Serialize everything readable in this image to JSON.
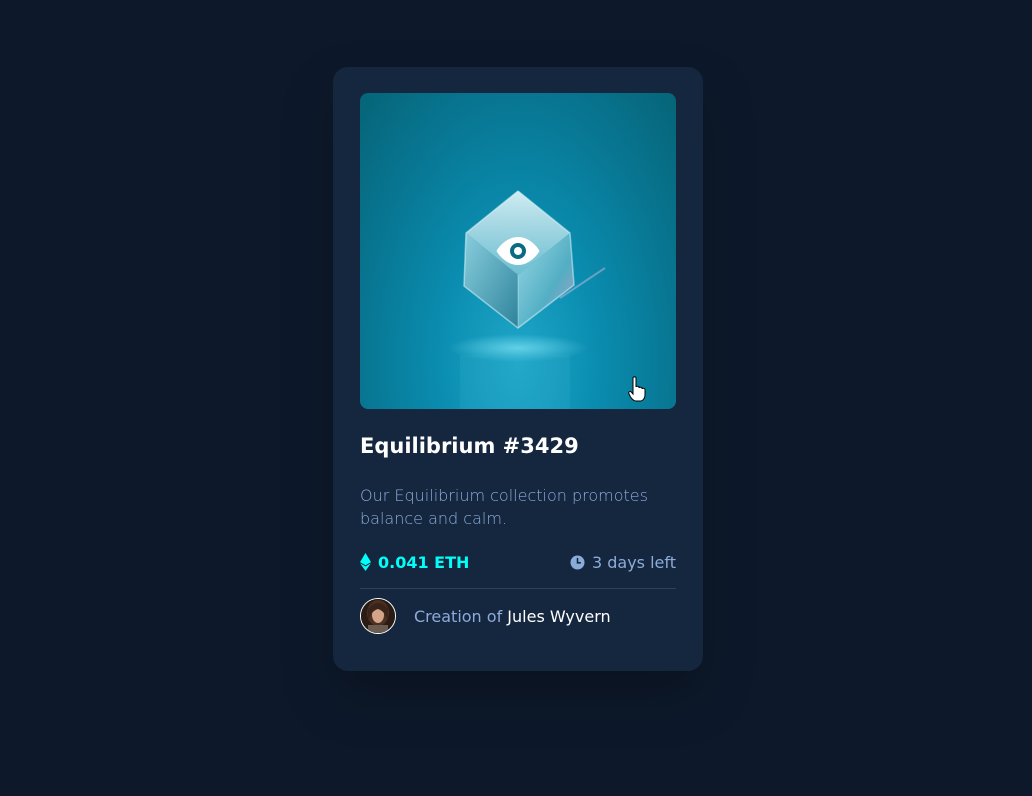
{
  "card": {
    "title": "Equilibrium #3429",
    "description": "Our Equilibrium collection promotes balance and calm.",
    "price": "0.041 ETH",
    "time_left": "3 days left",
    "creator_prefix": "Creation of",
    "creator_name": "Jules Wyvern"
  },
  "icons": {
    "eye": "eye-icon",
    "ethereum": "ethereum-icon",
    "clock": "clock-icon",
    "cursor": "hand-pointer-cursor-icon"
  },
  "colors": {
    "page_background": "#0d192b",
    "card_background": "#15263f",
    "accent_cyan": "#00fff8",
    "soft_blue": "#8bacd9",
    "white": "#ffffff"
  }
}
